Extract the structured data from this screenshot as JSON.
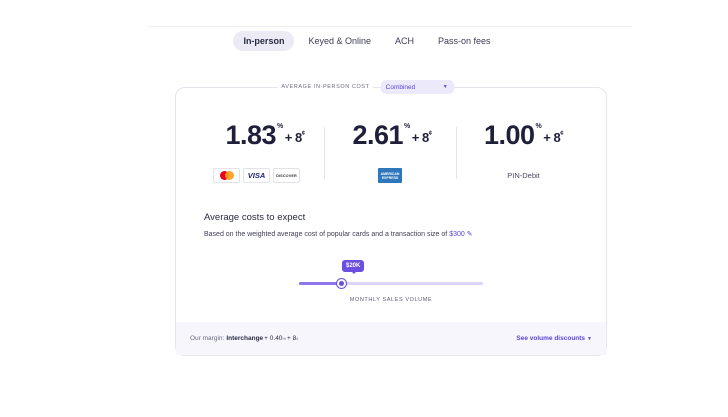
{
  "tabs": [
    {
      "label": "In-person",
      "active": true
    },
    {
      "label": "Keyed & Online",
      "active": false
    },
    {
      "label": "ACH",
      "active": false
    },
    {
      "label": "Pass-on fees",
      "active": false
    }
  ],
  "cost_header": {
    "label": "AVERAGE IN-PERSON COST",
    "select_value": "Combined"
  },
  "rates": [
    {
      "value": "1.83",
      "pct": "%",
      "fee": "+ 8",
      "cent": "¢"
    },
    {
      "value": "2.61",
      "pct": "%",
      "fee": "+ 8",
      "cent": "¢"
    },
    {
      "value": "1.00",
      "pct": "%",
      "fee": "+ 8",
      "cent": "¢"
    }
  ],
  "card_logos": {
    "visa": "VISA",
    "discover": "DISCOVER",
    "amex": "AMERICAN EXPRESS",
    "pin": "PIN-Debit"
  },
  "costs": {
    "title": "Average costs to expect",
    "subtitle": "Based on the weighted average cost of popular cards and a transaction size of",
    "amount": "$300"
  },
  "slider": {
    "value_label": "$20K",
    "fraction": 0.23,
    "label": "MONTHLY SALES VOLUME"
  },
  "footer": {
    "margin_prefix": "Our margin:",
    "margin_strong": "Interchange",
    "margin_value": "+ 0.40",
    "margin_pct": "%",
    "margin_fee": "+ 8",
    "margin_cent": "¢",
    "volume_link": "See volume discounts"
  },
  "colors": {
    "accent": "#5a45d4",
    "slider": "#6a4fe0",
    "footer_bg": "#f7f6fd"
  }
}
